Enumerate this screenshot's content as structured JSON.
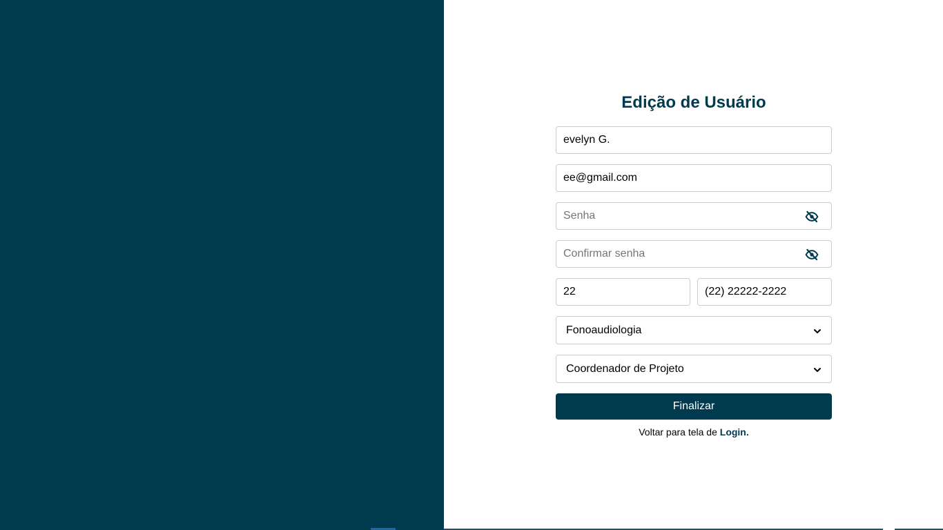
{
  "form": {
    "title": "Edição de Usuário",
    "name_value": "evelyn G.",
    "email_value": "ee@gmail.com",
    "password_placeholder": "Senha",
    "confirm_password_placeholder": "Confirmar senha",
    "ddd_value": "22",
    "phone_value": "(22) 22222-2222",
    "course_selected": "Fonoaudiologia",
    "role_selected": "Coordenador de Projeto",
    "submit_label": "Finalizar",
    "back_text": "Voltar para tela de",
    "back_link": "Login."
  },
  "icons": {
    "password_toggle": "eye-slash-icon",
    "confirm_toggle": "eye-slash-icon",
    "select_arrow": "chevron-down-icon"
  },
  "colors": {
    "brand": "#003a4f",
    "background": "#ffffff",
    "border": "#cccccc"
  }
}
